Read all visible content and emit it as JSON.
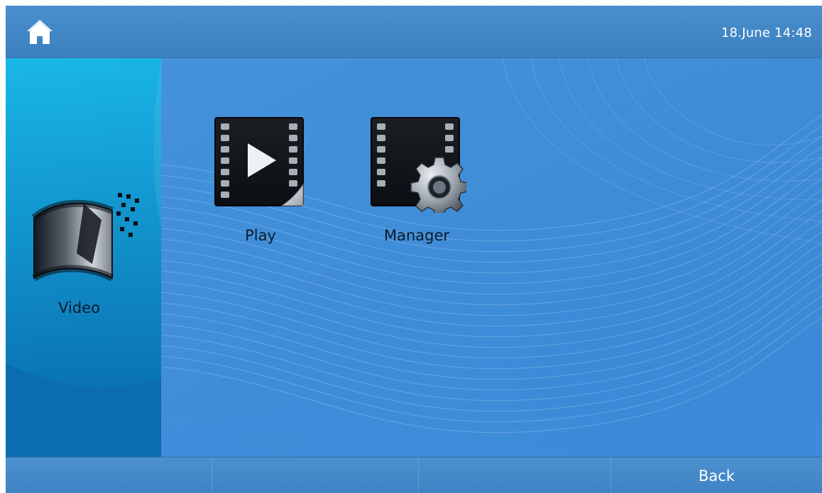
{
  "topbar": {
    "home_icon": "home-icon",
    "datetime": "18.June 14:48"
  },
  "module": {
    "label": "Video",
    "icon": "film-reel-icon"
  },
  "apps": [
    {
      "label": "Play",
      "icon": "film-play-icon"
    },
    {
      "label": "Manager",
      "icon": "film-gear-icon"
    }
  ],
  "bottombar": {
    "buttons": [
      "",
      "",
      "",
      "Back"
    ]
  },
  "colors": {
    "accent": "#3f8fd8",
    "topbar": "#4a8fce",
    "panel": "#0e6aa8",
    "text": "#ffffff"
  }
}
